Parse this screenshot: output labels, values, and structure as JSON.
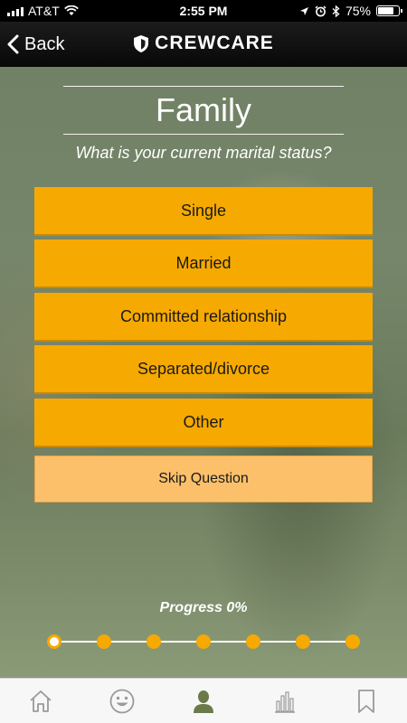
{
  "status_bar": {
    "carrier": "AT&T",
    "time": "2:55 PM",
    "battery": "75%",
    "icons": [
      "signal-icon",
      "wifi-icon",
      "location-icon",
      "alarm-icon",
      "bluetooth-icon",
      "battery-icon"
    ]
  },
  "nav": {
    "back_label": "Back",
    "brand": "CREWCARE",
    "brand_icon": "shield-icon"
  },
  "question": {
    "section_title": "Family",
    "prompt": "What is your current marital status?"
  },
  "options": [
    {
      "label": "Single"
    },
    {
      "label": "Married"
    },
    {
      "label": "Committed relationship"
    },
    {
      "label": "Separated/divorce"
    },
    {
      "label": "Other"
    }
  ],
  "skip_label": "Skip Question",
  "progress": {
    "label": "Progress 0%",
    "value_percent": 0,
    "total_steps": 7,
    "current_step": 1
  },
  "tabs": [
    {
      "name": "home-icon"
    },
    {
      "name": "smiley-icon"
    },
    {
      "name": "profile-icon",
      "active": true
    },
    {
      "name": "stats-icon"
    },
    {
      "name": "bookmark-icon"
    }
  ],
  "colors": {
    "accent": "#f6a900",
    "skip": "#fcc06a",
    "active_tab": "#6b7a4a",
    "inactive_tab": "#9a9a9a"
  }
}
